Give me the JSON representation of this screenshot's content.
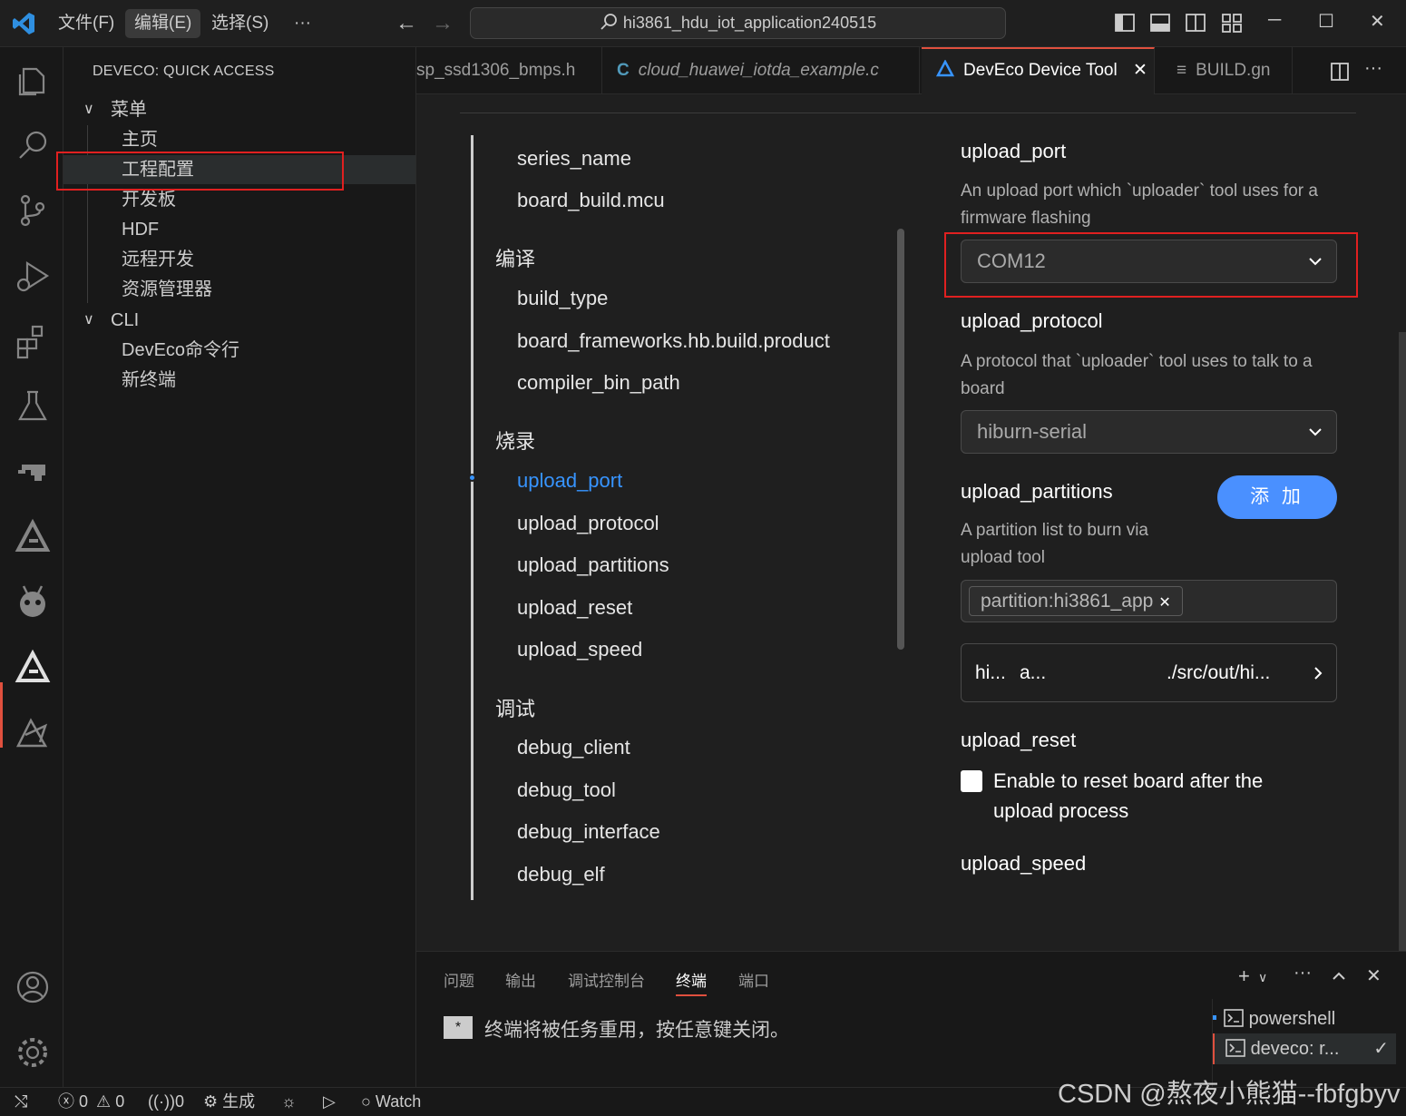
{
  "titlebar": {
    "menus": [
      "文件(F)",
      "编辑(E)",
      "选择(S)",
      "···"
    ],
    "search_text": "hi3861_hdu_iot_application240515",
    "window_controls": [
      "─",
      "☐",
      "✕"
    ]
  },
  "sidebar": {
    "title": "DEVECO: QUICK ACCESS",
    "menu_group": "菜单",
    "menu_items": [
      "主页",
      "工程配置",
      "开发板",
      "HDF",
      "远程开发",
      "资源管理器"
    ],
    "cli_group": "CLI",
    "cli_items": [
      "DevEco命令行",
      "新终端"
    ]
  },
  "tabs": [
    {
      "label": "sp_ssd1306_bmps.h",
      "icon": "header-file-icon"
    },
    {
      "label": "cloud_huawei_iotda_example.c",
      "icon": "c-file-icon",
      "prefix": "C"
    },
    {
      "label": "DevEco Device Tool",
      "icon": "deveco-icon",
      "close": "✕"
    },
    {
      "label": "BUILD.gn",
      "icon": "gn-file-icon",
      "prefix": "≡"
    }
  ],
  "nav": {
    "items_top": [
      "series_name",
      "board_build.mcu"
    ],
    "group_compile": "编译",
    "items_compile": [
      "build_type",
      "board_frameworks.hb.build.product",
      "compiler_bin_path"
    ],
    "group_burn": "烧录",
    "items_burn": [
      "upload_port",
      "upload_protocol",
      "upload_partitions",
      "upload_reset",
      "upload_speed"
    ],
    "group_debug": "调试",
    "items_debug": [
      "debug_client",
      "debug_tool",
      "debug_interface",
      "debug_elf"
    ]
  },
  "config": {
    "upload_port": {
      "title": "upload_port",
      "desc": "An upload port which `uploader` tool uses for a firmware flashing",
      "value": "COM12"
    },
    "upload_protocol": {
      "title": "upload_protocol",
      "desc": "A protocol that `uploader` tool uses to talk to a board",
      "value": "hiburn-serial"
    },
    "upload_partitions": {
      "title": "upload_partitions",
      "desc": "A partition list to burn via upload tool",
      "add_label": "添 加",
      "tag": "partition:hi3861_app",
      "card_col1": "hi...",
      "card_col2": "a...",
      "card_col3": "./src/out/hi..."
    },
    "upload_reset": {
      "title": "upload_reset",
      "label": "Enable to reset board after the upload process",
      "checked": false
    },
    "upload_speed": {
      "title": "upload_speed"
    }
  },
  "panel": {
    "tabs": [
      "问题",
      "输出",
      "调试控制台",
      "终端",
      "端口"
    ],
    "active_tab": "终端",
    "badge": "*",
    "message": "终端将被任务重用，按任意键关闭。",
    "terminals": [
      "powershell",
      "deveco: r..."
    ]
  },
  "statusbar": {
    "errors": "0",
    "warnings": "0",
    "ports": "0",
    "build": "生成",
    "watch": "Watch"
  },
  "watermark": "CSDN @熬夜小熊猫--fbfgbyv",
  "colors": {
    "accent_red": "#e0503e",
    "link_blue": "#3794ff",
    "button_blue": "#4a90ff",
    "highlight_box": "#e02020"
  }
}
